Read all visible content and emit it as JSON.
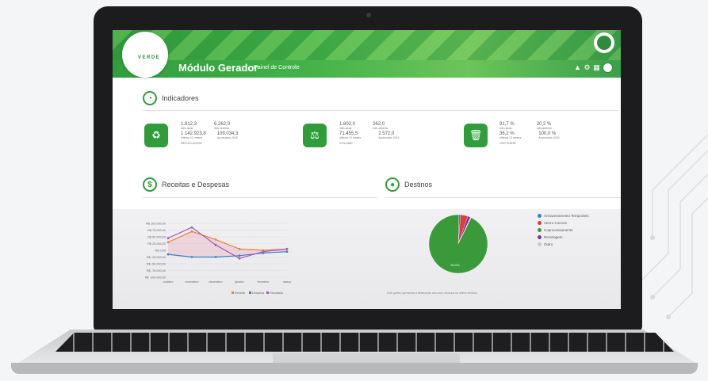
{
  "header": {
    "logo_line1": "",
    "logo_line2": "VERDE",
    "title": "Módulo Gerador",
    "subtitle": "Painel de Controle"
  },
  "indicadores": {
    "title": "Indicadores",
    "cards": [
      {
        "icon": "recycle-icon",
        "v1": "1.812,3",
        "l1": "mês atual",
        "v2": "6.262,0",
        "l2": "mês anterior",
        "v3": "1.142.923,8",
        "l3": "últimos 12 meses",
        "v4": "109.034,3",
        "l4": "Acumulado 2019",
        "footer": "RECICLAGEM"
      },
      {
        "icon": "weight-icon",
        "v1": "1.802,0",
        "l1": "mês atual",
        "v2": "262,0",
        "l2": "mês anterior",
        "v3": "71.455,5",
        "l3": "últimos 12 meses",
        "v4": "2.572,0",
        "l4": "Acumulado 2019",
        "footer": "VOLUME"
      },
      {
        "icon": "trash-icon",
        "v1": "91,7 %",
        "l1": "mês atual",
        "v2": "20,2 %",
        "l2": "mês anterior",
        "v3": "36,2 %",
        "l3": "últimos 12 meses",
        "v4": "100,0 %",
        "l4": "Acumulado 2019",
        "footer": "USO ESRB"
      }
    ]
  },
  "receitas": {
    "title": "Receitas e Despesas"
  },
  "destinos": {
    "title": "Destinos",
    "footer_note": "Este gráfico apresenta a destinação dos seus resíduos na última semana"
  },
  "colors": {
    "brand": "#2f9d3a",
    "receita": "#e8823a",
    "despesa": "#3c7fc4",
    "resultado": "#a45bb8"
  },
  "chart_data": [
    {
      "type": "line",
      "title": "Receitas e Despesas",
      "categories": [
        "outubro",
        "novembro",
        "dezembro",
        "janeiro",
        "fevereiro",
        "março"
      ],
      "yticks": [
        "R$ 100.000,00",
        "R$ 75.000,00",
        "R$ 50.000,00",
        "R$ 25.000,00",
        "R$ 0,00",
        "R$ -25.000,00",
        "R$ -50.000,00",
        "R$ -75.000,00",
        "R$ -100.000,00"
      ],
      "ylim": [
        -100000,
        100000
      ],
      "series": [
        {
          "name": "Receita",
          "values": [
            30000,
            70000,
            40000,
            5000,
            0,
            5000
          ]
        },
        {
          "name": "Despesa",
          "values": [
            -15000,
            -25000,
            -25000,
            -20000,
            -10000,
            -5000
          ]
        },
        {
          "name": "Resultado",
          "values": [
            45000,
            85000,
            20000,
            -30000,
            -5000,
            5000
          ]
        }
      ]
    },
    {
      "type": "pie",
      "title": "Destinos",
      "slices": [
        {
          "name": "Armazenamento Temporário",
          "value": 1.0
        },
        {
          "name": "Aterro Comum",
          "value": 4.0
        },
        {
          "name": "Coprocessamento",
          "value": 93.0
        },
        {
          "name": "Reciclagem",
          "value": 1.5
        },
        {
          "name": "Outro",
          "value": 0.5
        }
      ],
      "label": "93,0%"
    }
  ]
}
